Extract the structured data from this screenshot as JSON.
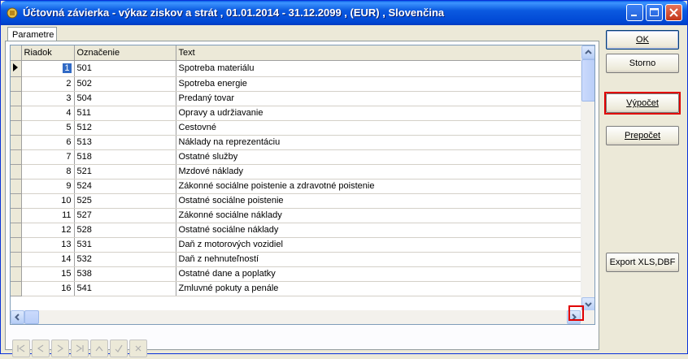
{
  "window": {
    "title": "Účtovná závierka - výkaz ziskov a strát ,  01.01.2014 - 31.12.2099 ,  (EUR) ,  Slovenčina"
  },
  "tabs": [
    {
      "label": "Parametre",
      "active": true
    }
  ],
  "grid": {
    "columns": [
      "Riadok",
      "Označenie",
      "Text"
    ],
    "rows": [
      {
        "riadok": "1",
        "oznacenie": "501",
        "text": "Spotreba materiálu"
      },
      {
        "riadok": "2",
        "oznacenie": "502",
        "text": "Spotreba energie"
      },
      {
        "riadok": "3",
        "oznacenie": "504",
        "text": "Predaný tovar"
      },
      {
        "riadok": "4",
        "oznacenie": "511",
        "text": "Opravy a udržiavanie"
      },
      {
        "riadok": "5",
        "oznacenie": "512",
        "text": "Cestovné"
      },
      {
        "riadok": "6",
        "oznacenie": "513",
        "text": "Náklady na reprezentáciu"
      },
      {
        "riadok": "7",
        "oznacenie": "518",
        "text": "Ostatné služby"
      },
      {
        "riadok": "8",
        "oznacenie": "521",
        "text": "Mzdové náklady"
      },
      {
        "riadok": "9",
        "oznacenie": "524",
        "text": "Zákonné sociálne poistenie a zdravotné poistenie"
      },
      {
        "riadok": "10",
        "oznacenie": "525",
        "text": "Ostatné sociálne poistenie"
      },
      {
        "riadok": "11",
        "oznacenie": "527",
        "text": "Zákonné sociálne náklady"
      },
      {
        "riadok": "12",
        "oznacenie": "528",
        "text": "Ostatné sociálne náklady"
      },
      {
        "riadok": "13",
        "oznacenie": "531",
        "text": "Daň z motorových vozidiel"
      },
      {
        "riadok": "14",
        "oznacenie": "532",
        "text": "Daň z nehnuteľností"
      },
      {
        "riadok": "15",
        "oznacenie": "538",
        "text": "Ostatné dane a poplatky"
      },
      {
        "riadok": "16",
        "oznacenie": "541",
        "text": "Zmluvné pokuty a penále"
      }
    ],
    "selected_row": 0
  },
  "buttons": {
    "ok": "OK",
    "storno": "Storno",
    "vypocet": "Výpočet",
    "prepocet": "Prepočet",
    "export": "Export XLS,DBF"
  },
  "navigator": [
    "first-icon",
    "prior-icon",
    "next-icon",
    "last-icon",
    "insert-icon",
    "post-icon",
    "cancel-icon"
  ],
  "colors": {
    "titlebar": "#0054e3",
    "selection": "#316ac5",
    "highlight": "#e00000"
  }
}
